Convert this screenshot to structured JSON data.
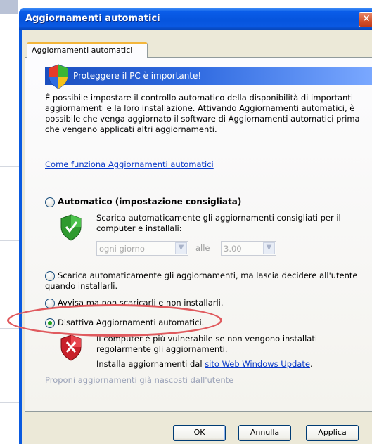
{
  "window": {
    "title": "Aggiornamenti automatici",
    "close_glyph": "✕"
  },
  "tab": {
    "label": "Aggiornamenti automatici"
  },
  "banner": {
    "text": "Proteggere il PC è importante!",
    "icon": "security-shield-icon"
  },
  "intro": {
    "line1": "È possibile impostare il controllo automatico della disponibilità di importanti",
    "line2": "aggiornamenti e la loro installazione. Attivando Aggiornamenti automatici, è",
    "line3": "possibile che venga aggiornato il software di Aggiornamenti automatici prima",
    "line4": "che vengano applicati altri aggiornamenti."
  },
  "how_link": "Come funziona Aggiornamenti automatici",
  "options": {
    "automatic": {
      "label": "Automatico (impostazione consigliata)",
      "desc1": "Scarica automaticamente gli aggiornamenti consigliati per il",
      "desc2": "computer e installali:",
      "frequency_value": "ogni giorno",
      "at_label": "alle",
      "time_value": "3.00",
      "icon": "shield-check-icon"
    },
    "download_only": {
      "line1": "Scarica automaticamente gli aggiornamenti, ma lascia decidere all'utente",
      "line2": "quando installarli."
    },
    "notify_only": {
      "label": "Avvisa ma non scaricarli e non installarli."
    },
    "disable": {
      "label": "Disattiva Aggiornamenti automatici.",
      "warn1": "Il computer è più vulnerabile se non vengono installati",
      "warn2": "regolarmente gli aggiornamenti.",
      "install_prefix": "Installa aggiornamenti dal ",
      "install_link": "sito Web Windows Update",
      "install_suffix": ".",
      "icon": "shield-x-icon",
      "selected": true
    }
  },
  "hidden_updates_link": "Proponi aggiornamenti già nascosti dall'utente",
  "buttons": {
    "ok": "OK",
    "cancel": "Annulla",
    "apply": "Applica"
  },
  "colors": {
    "highlight_ellipse": "#e05a5e",
    "titlebar": "#0654dd",
    "link": "#0a39c8"
  }
}
